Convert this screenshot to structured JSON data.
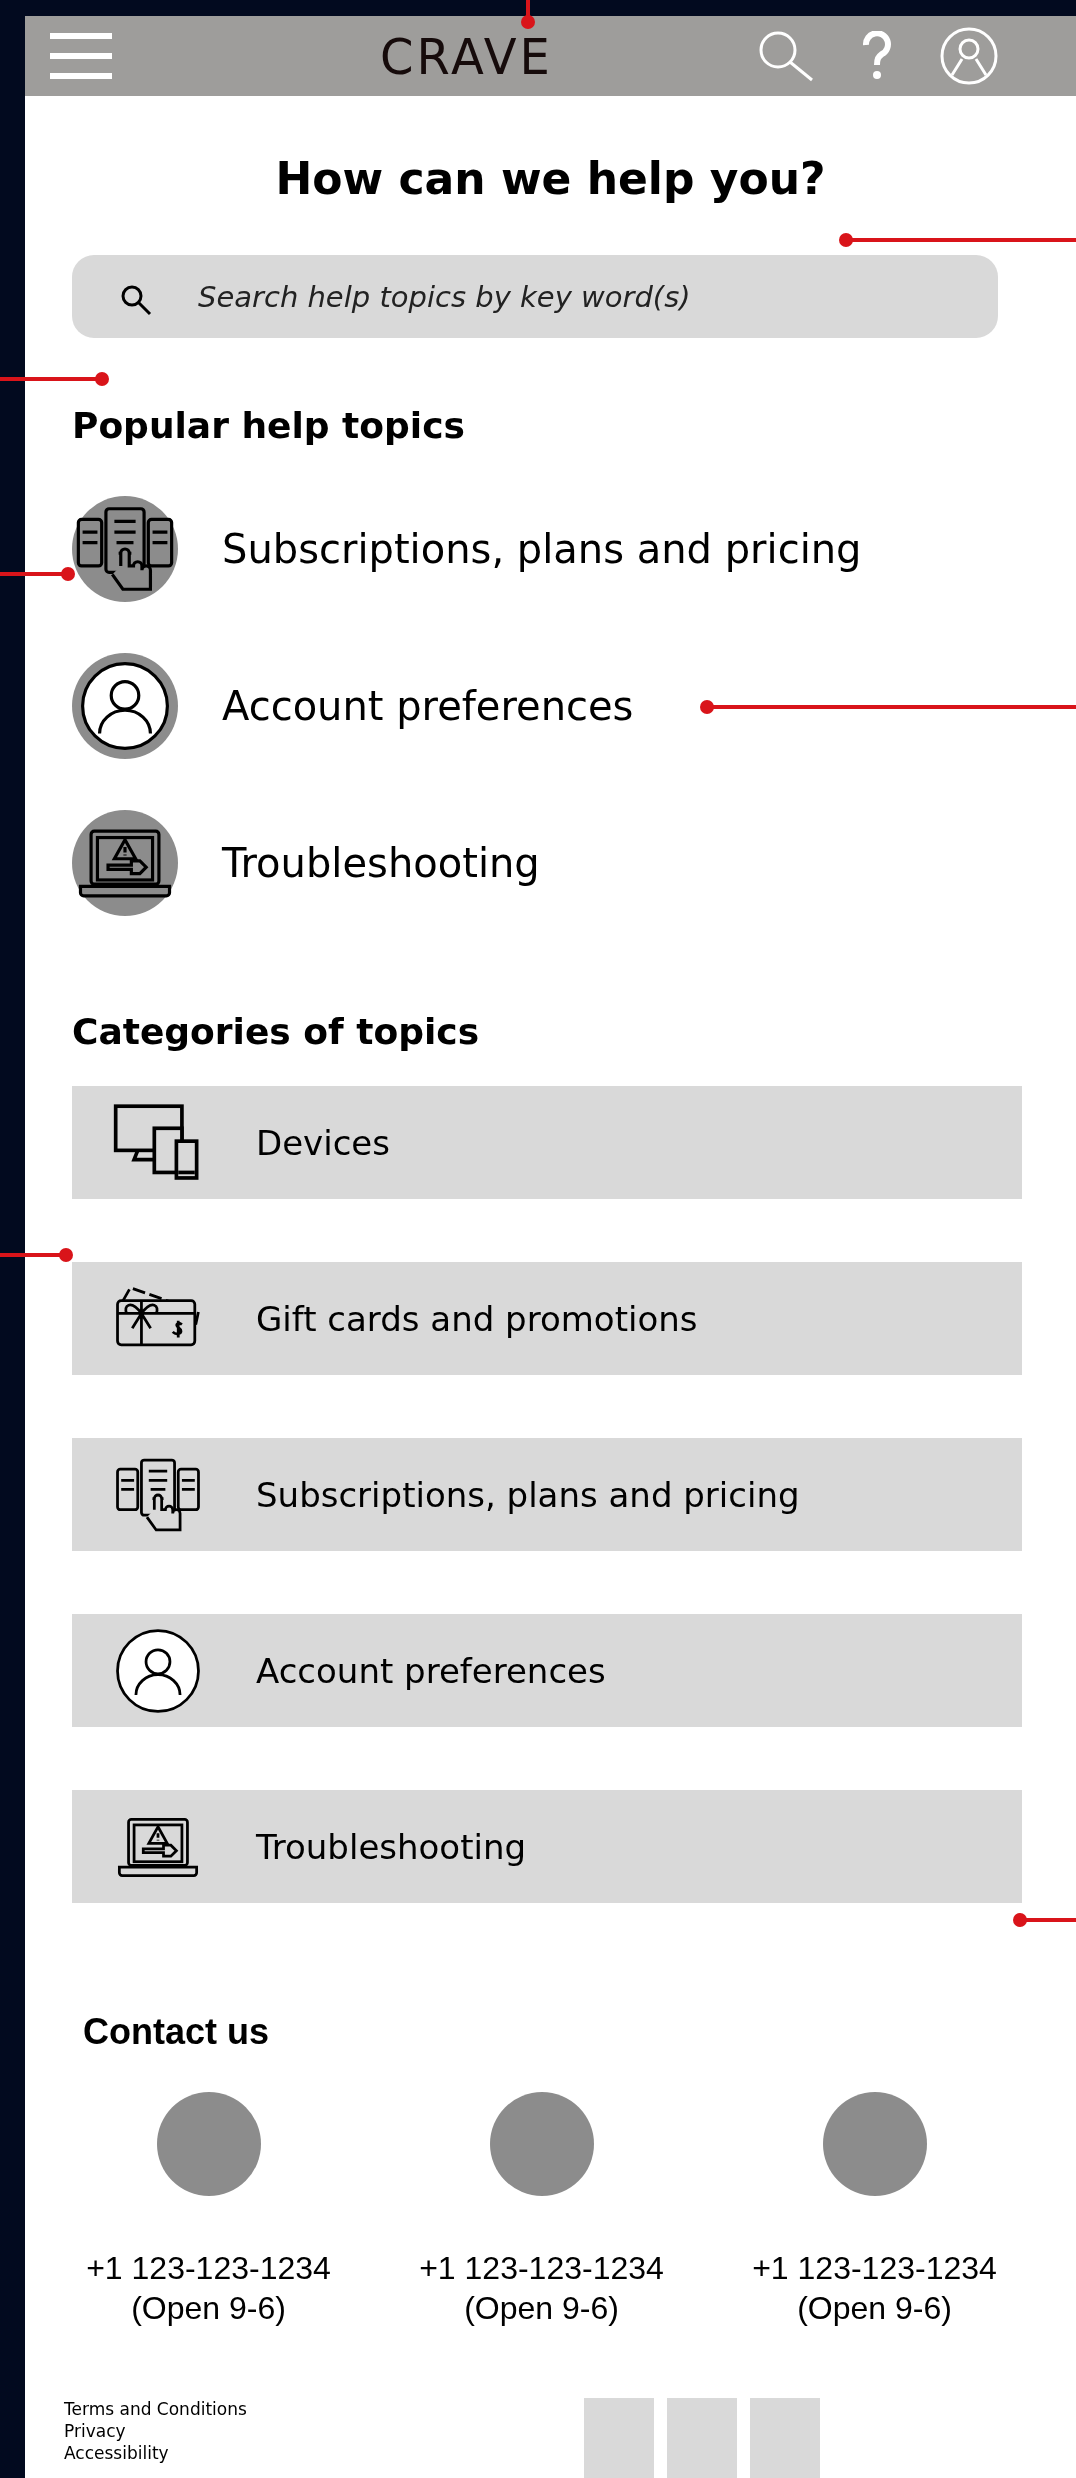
{
  "header": {
    "logo": "CRAVE"
  },
  "title": "How can we help you?",
  "search": {
    "placeholder": "Search help topics by key word(s)"
  },
  "popular": {
    "heading": "Popular help topics",
    "items": [
      {
        "label": "Subscriptions, plans and pricing",
        "kind": "subscriptions"
      },
      {
        "label": "Account preferences",
        "kind": "account"
      },
      {
        "label": "Troubleshooting",
        "kind": "troubleshooting"
      }
    ]
  },
  "categories": {
    "heading": "Categories of topics",
    "items": [
      {
        "label": "Devices",
        "kind": "devices"
      },
      {
        "label": "Gift cards and promotions",
        "kind": "gift"
      },
      {
        "label": "Subscriptions, plans and pricing",
        "kind": "subscriptions"
      },
      {
        "label": "Account preferences",
        "kind": "account"
      },
      {
        "label": "Troubleshooting",
        "kind": "troubleshooting"
      }
    ]
  },
  "contact": {
    "heading": "Contact us",
    "items": [
      {
        "phone": "+1 123-123-1234",
        "hours": "(Open 9-6)"
      },
      {
        "phone": "+1 123-123-1234",
        "hours": "(Open 9-6)"
      },
      {
        "phone": "+1 123-123-1234",
        "hours": "(Open 9-6)"
      }
    ]
  },
  "footer": {
    "links": [
      "Terms and Conditions",
      "Privacy",
      "Accessibility"
    ]
  }
}
